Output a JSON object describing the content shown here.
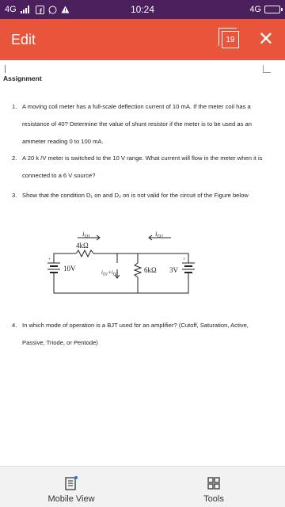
{
  "status_bar": {
    "network_left": "4G",
    "time": "10:24",
    "network_right": "4G"
  },
  "app_bar": {
    "title": "Edit",
    "page_count": "19"
  },
  "document": {
    "heading": "Assignment",
    "questions": [
      {
        "num": "1.",
        "text": "A moving coil meter has a full-scale deflection current of 10 mA. If the meter coil has a resistance of 40? Determine the value of shunt resistor if the meter is to be used as an ammeter reading 0 to 100 mA."
      },
      {
        "num": "2.",
        "text": "A 20 k /V meter is switched to the 10 V range. What current will flow in the meter when it is connected to a 6 V source?"
      },
      {
        "num": "3.",
        "text": "Show that the condition D₁ on and D₂ on is not valid for the circuit of the Figure below"
      },
      {
        "num": "4.",
        "text": "In which mode of operation is a BJT used for an amplifier? (Cutoff, Saturation, Active, Passive, Triode, or Pentode)"
      }
    ],
    "circuit": {
      "i_d1": "i",
      "i_d1_sub": "D1",
      "i_d2": "i",
      "i_d2_sub": "D2",
      "r1": "4kΩ",
      "v1": "10V",
      "r2": "6kΩ",
      "v2": "3V",
      "mid_label": "i",
      "mid_sub1": "D1",
      "mid_plus": "+i",
      "mid_sub2": "D2"
    }
  },
  "bottom_bar": {
    "mobile_view_label": "Mobile View",
    "tools_label": "Tools"
  },
  "colors": {
    "status_bg": "#4a1f5c",
    "app_bar_bg": "#e8553a",
    "accent_dot": "#2a6ef0"
  }
}
